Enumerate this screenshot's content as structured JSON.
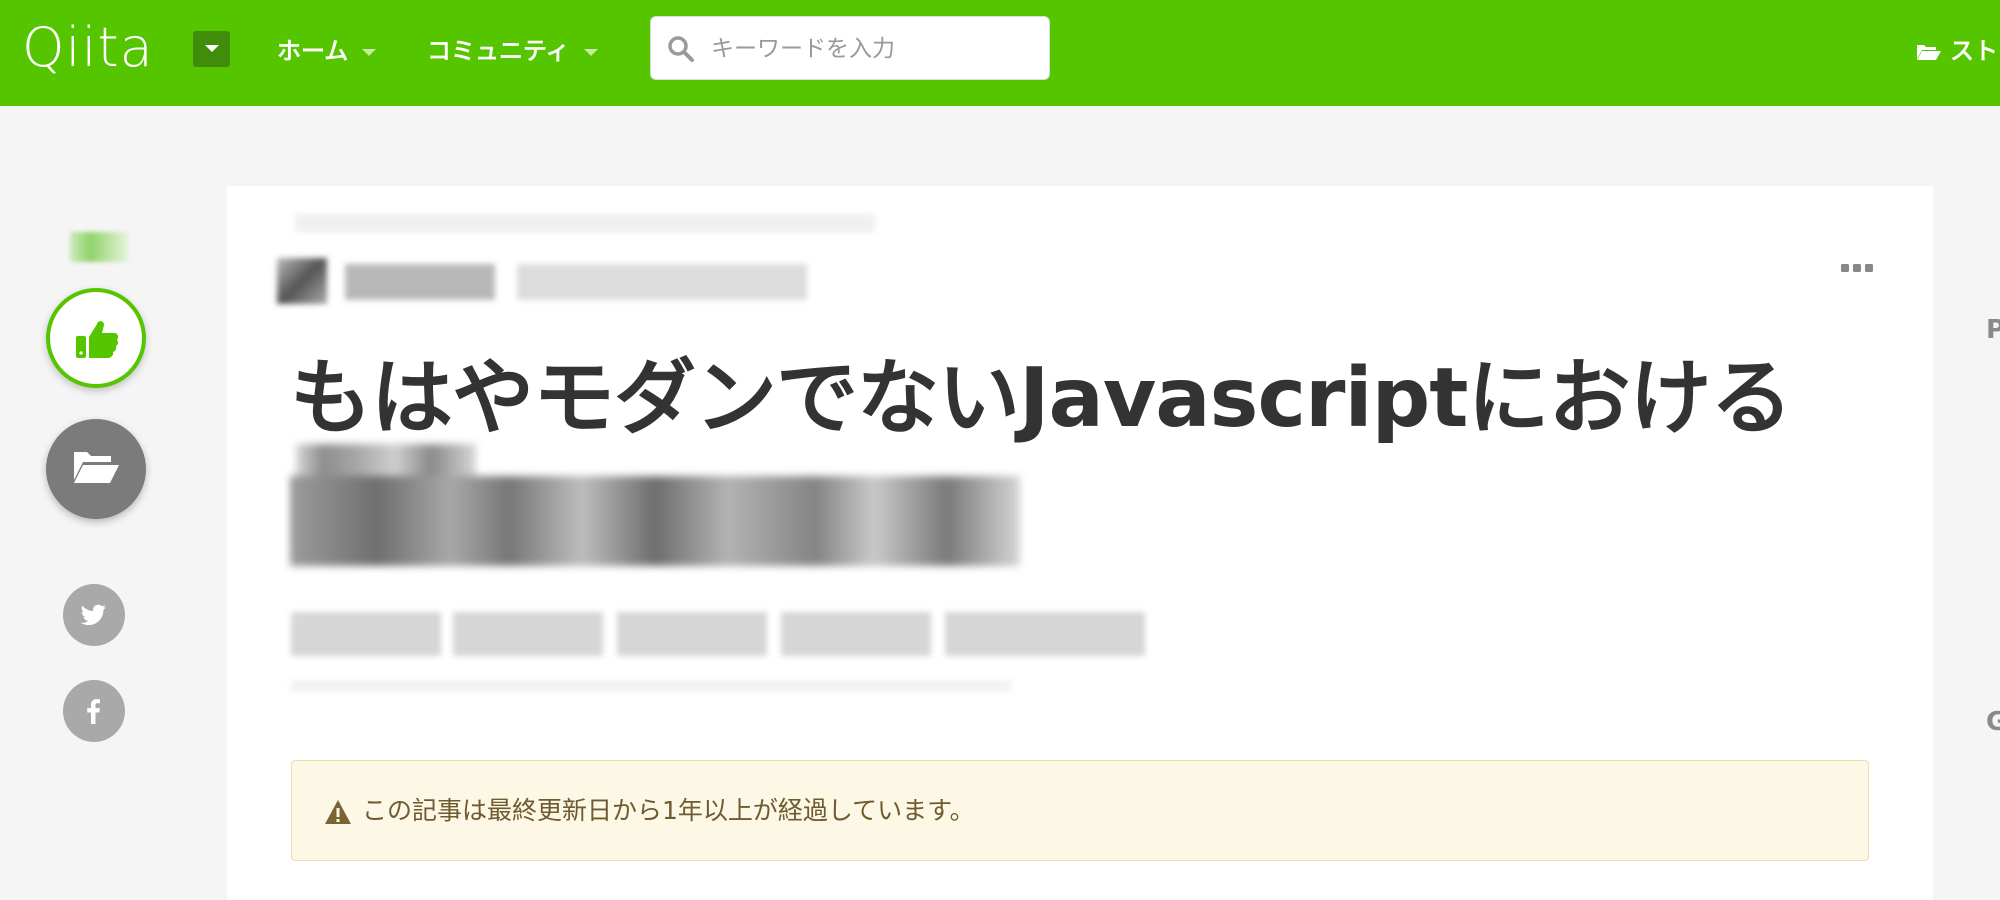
{
  "header": {
    "logo": "Qiita",
    "nav": [
      {
        "label": "ホーム"
      },
      {
        "label": "コミュニティ"
      }
    ],
    "search": {
      "placeholder": "キーワードを入力"
    },
    "stock_label": "スト",
    "icons": [
      "chevron-down-icon",
      "search-icon",
      "folder-open-icon"
    ]
  },
  "sidebar": {
    "icons": [
      "thumbs-up-icon",
      "folder-open-icon",
      "twitter-icon",
      "facebook-icon"
    ]
  },
  "article": {
    "title": "もはやモダンでないJavascriptにおける",
    "notice": "この記事は最終更新日から1年以上が経過しています。"
  },
  "right_column": {
    "stubs": [
      "P",
      "G"
    ]
  },
  "colors": {
    "brand": "#55c500",
    "brand_dark": "#3f8d0b",
    "notice_bg": "#fdf7e5",
    "notice_text": "#6e5b2f"
  }
}
